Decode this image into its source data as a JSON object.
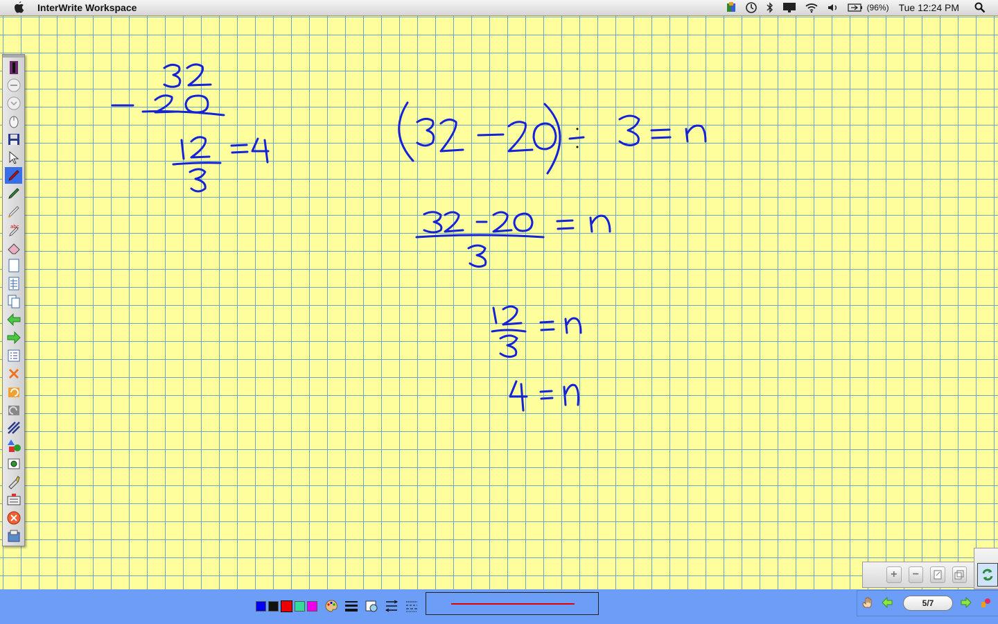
{
  "menubar": {
    "app_title": "InterWrite Workspace",
    "battery": "(96%)",
    "clock": "Tue 12:24 PM",
    "icons": [
      "apple-icon",
      "app-status-icon",
      "time-machine-icon",
      "bluetooth-icon",
      "display-icon",
      "wifi-icon",
      "volume-icon",
      "battery-icon",
      "spotlight-search-icon"
    ]
  },
  "palette": {
    "tools": [
      "pen-toolbar-icon",
      "circle-button-1-icon",
      "circle-button-2-icon",
      "mouse-icon",
      "save-icon",
      "select-arrow-icon",
      "pen-icon",
      "highlighter-icon",
      "marker-icon",
      "text-recognition-icon",
      "eraser-icon",
      "new-page-icon",
      "page-template-icon",
      "copy-page-icon",
      "previous-page-icon",
      "next-page-icon",
      "page-sorter-icon",
      "delete-icon",
      "undo-icon",
      "redo-icon",
      "pattern-icon",
      "shapes-icon",
      "screen-capture-icon",
      "pointer-tool-icon",
      "keyboard-icon",
      "close-icon",
      "export-icon"
    ],
    "accent": "#1422d8"
  },
  "bottom": {
    "colors": [
      "#0000ee",
      "#111111",
      "#ee0000",
      "#33dd99",
      "#ee00ee"
    ],
    "selected_color": "#ee0000",
    "tools": [
      "palette-icon",
      "line-width-icon",
      "fill-icon",
      "line-style-icon",
      "dash-style-icon"
    ],
    "line_color": "#e00000",
    "page_indicator": "5/7"
  },
  "zoom": {
    "buttons": [
      "zoom-in-icon",
      "zoom-out-icon",
      "page-icon",
      "window-icon"
    ]
  },
  "pagenav": {
    "icons": [
      "hand-icon",
      "previous-page-icon",
      "next-page-icon",
      "tool-icon"
    ]
  },
  "ink_color": "#1422d8"
}
